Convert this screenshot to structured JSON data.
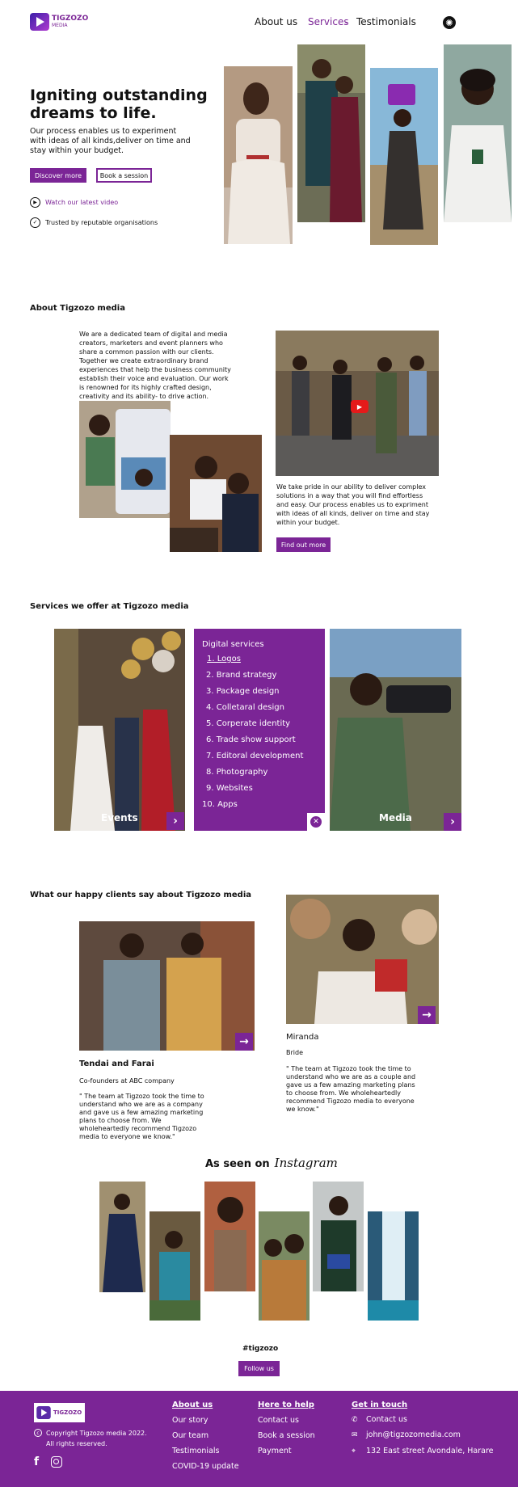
{
  "header": {
    "logo_text": "TIGZOZO",
    "logo_sub": "MEDIA",
    "nav": [
      {
        "label": "About us"
      },
      {
        "label": "Services"
      },
      {
        "label": "Testimonials"
      }
    ]
  },
  "hero": {
    "title_line1": "Igniting outstanding",
    "title_line2": "dreams to life.",
    "body": "Our process enables us to experiment with ideas of all kinds,deliver on time and stay within your budget.",
    "primary_label": "Discover more",
    "secondary_label": "Book a session",
    "video_link": "Watch our latest video",
    "trusted": "Trusted by reputable organisations"
  },
  "about": {
    "heading": "About Tigzozo media",
    "intro": "We are a dedicated team of digital and media creators, marketers and event planners who share a common passion with our clients. Together we create extraordinary brand experiences that help the business community establish their voice and evaluation. Our work is renowned for its highly crafted design, creativity and its ability- to drive action.",
    "pride": "We take pride in our ability to deliver complex solutions in a way that you will find effortless and easy. Our process enables us to expriment with ideas of all kinds, deliver on time and stay within your budget.",
    "cta": "Find out more"
  },
  "services": {
    "heading": "Services we offer at Tigzozo media",
    "events_label": "Events",
    "media_label": "Media",
    "digital_title": "Digital services",
    "items": [
      "1. Logos",
      "2. Brand strategy",
      "3. Package design",
      "4. Colletaral design",
      "5. Corperate identity",
      "6. Trade show support",
      "7. Editoral development",
      "8. Photography",
      "9. Websites",
      "10. Apps"
    ]
  },
  "testimonials": {
    "heading": "What our happy clients say about Tigzozo media",
    "t1": {
      "name": "Tendai and Farai",
      "role": "Co-founders at ABC company",
      "quote": "\" The team at Tigzozo took the time to understand who we are as a company and gave us a few amazing marketing plans to choose from. We wholeheartedly recommend Tigzozo media to everyone we know.\""
    },
    "t2": {
      "name": "Miranda",
      "role": "Bride",
      "quote": "\" The team at Tigzozo took the time to understand who we are as a couple and gave us a few amazing marketing plans to choose from. We wholeheartedly recommend Tigzozo media to everyone we know.\""
    }
  },
  "instagram": {
    "heading_prefix": "As seen on",
    "heading_script": "Instagram",
    "hashtag": "#tigzozo",
    "follow": "Follow us"
  },
  "footer": {
    "copyright": "Copyright Tigzozo media 2022.",
    "rights": "All rights reserved.",
    "col1_title": "About us",
    "col1": [
      "Our story",
      "Our team",
      "Testimonials",
      "COVID-19 update"
    ],
    "col2_title": "Here to help",
    "col2": [
      "Contact us",
      "Book a session",
      "Payment"
    ],
    "col3_title": "Get in touch",
    "contact_label": "Contact us",
    "email": "john@tigzozomedia.com",
    "address": "132 East street Avondale, Harare"
  },
  "colors": {
    "accent": "#7b2596",
    "footer_bg": "#7b2596"
  }
}
